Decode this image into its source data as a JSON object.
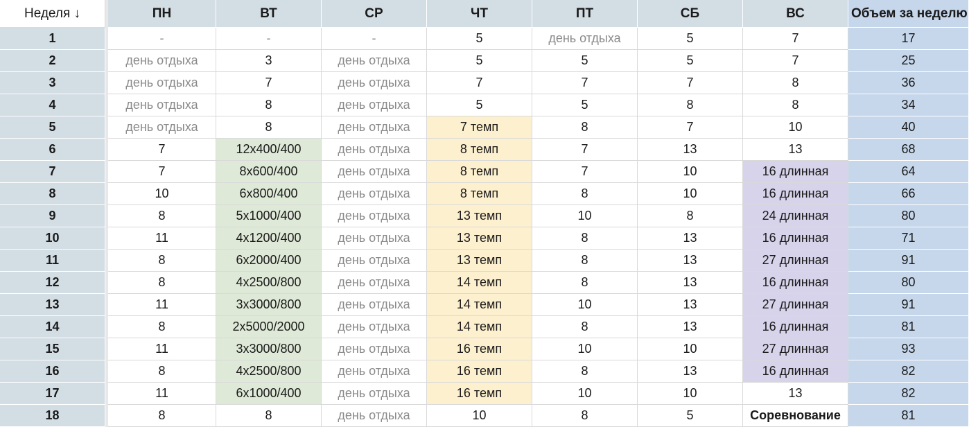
{
  "header": {
    "week_label": "Неделя ↓",
    "days": [
      "ПН",
      "ВТ",
      "СР",
      "ЧТ",
      "ПТ",
      "СБ",
      "ВС"
    ],
    "volume_label": "Объем за неделю"
  },
  "colors": {
    "header_bg": "#d3dde4",
    "volume_bg": "#c6d7ec",
    "intervals_green": "#dfe9d8",
    "tempo_yellow": "#fdf0cf",
    "long_purple": "#d7d3ea",
    "rest_text": "#8a8a8a"
  },
  "rows": [
    {
      "week": "1",
      "days": [
        "-",
        "-",
        "-",
        "5",
        "день отдыха",
        "5",
        "7"
      ],
      "volume": "17"
    },
    {
      "week": "2",
      "days": [
        "день отдыха",
        "3",
        "день отдыха",
        "5",
        "5",
        "5",
        "7"
      ],
      "volume": "25"
    },
    {
      "week": "3",
      "days": [
        "день отдыха",
        "7",
        "день отдыха",
        "7",
        "7",
        "7",
        "8"
      ],
      "volume": "36"
    },
    {
      "week": "4",
      "days": [
        "день отдыха",
        "8",
        "день отдыха",
        "5",
        "5",
        "8",
        "8"
      ],
      "volume": "34"
    },
    {
      "week": "5",
      "days": [
        "день отдыха",
        "8",
        "день отдыха",
        "7 темп",
        "8",
        "7",
        "10"
      ],
      "volume": "40"
    },
    {
      "week": "6",
      "days": [
        "7",
        "12x400/400",
        "день отдыха",
        "8 темп",
        "7",
        "13",
        "13"
      ],
      "volume": "68"
    },
    {
      "week": "7",
      "days": [
        "7",
        "8x600/400",
        "день отдыха",
        "8 темп",
        "7",
        "10",
        "16 длинная"
      ],
      "volume": "64"
    },
    {
      "week": "8",
      "days": [
        "10",
        "6x800/400",
        "день отдыха",
        "8 темп",
        "8",
        "10",
        "16 длинная"
      ],
      "volume": "66"
    },
    {
      "week": "9",
      "days": [
        "8",
        "5x1000/400",
        "день отдыха",
        "13 темп",
        "10",
        "8",
        "24 длинная"
      ],
      "volume": "80"
    },
    {
      "week": "10",
      "days": [
        "11",
        "4x1200/400",
        "день отдыха",
        "13 темп",
        "8",
        "13",
        "16 длинная"
      ],
      "volume": "71"
    },
    {
      "week": "11",
      "days": [
        "8",
        "6x2000/400",
        "день отдыха",
        "13 темп",
        "8",
        "13",
        "27 длинная"
      ],
      "volume": "91"
    },
    {
      "week": "12",
      "days": [
        "8",
        "4x2500/800",
        "день отдыха",
        "14 темп",
        "8",
        "13",
        "16 длинная"
      ],
      "volume": "80"
    },
    {
      "week": "13",
      "days": [
        "11",
        "3x3000/800",
        "день отдыха",
        "14 темп",
        "10",
        "13",
        "27 длинная"
      ],
      "volume": "91"
    },
    {
      "week": "14",
      "days": [
        "8",
        "2x5000/2000",
        "день отдыха",
        "14 темп",
        "8",
        "13",
        "16 длинная"
      ],
      "volume": "81"
    },
    {
      "week": "15",
      "days": [
        "11",
        "3x3000/800",
        "день отдыха",
        "16 темп",
        "10",
        "10",
        "27 длинная"
      ],
      "volume": "93"
    },
    {
      "week": "16",
      "days": [
        "8",
        "4x2500/800",
        "день отдыха",
        "16 темп",
        "8",
        "13",
        "16 длинная"
      ],
      "volume": "82"
    },
    {
      "week": "17",
      "days": [
        "11",
        "6x1000/400",
        "день отдыха",
        "16 темп",
        "10",
        "10",
        "13"
      ],
      "volume": "82"
    },
    {
      "week": "18",
      "days": [
        "8",
        "8",
        "день отдыха",
        "10",
        "8",
        "5",
        "Соревнование"
      ],
      "volume": "81"
    }
  ]
}
